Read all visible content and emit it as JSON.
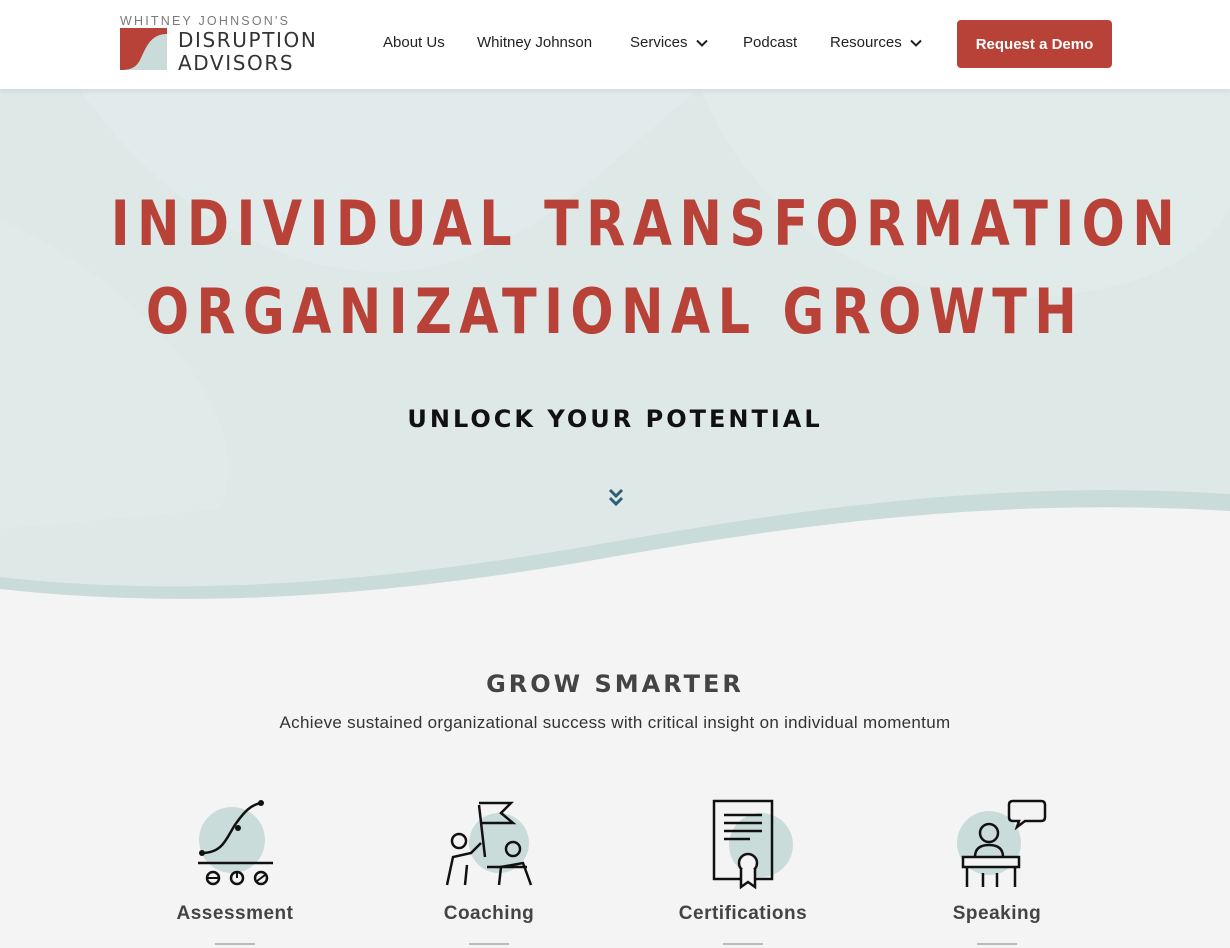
{
  "brand": {
    "top_line": "WHITNEY JOHNSON'S",
    "line1": "DISRUPTION",
    "line2": "ADVISORS",
    "colors": {
      "red": "#b84238",
      "teal": "#c9dcd9"
    }
  },
  "nav": {
    "items": [
      {
        "label": "About Us",
        "dropdown": false
      },
      {
        "label": "Whitney Johnson",
        "dropdown": false
      },
      {
        "label": "Services",
        "dropdown": true
      },
      {
        "label": "Podcast",
        "dropdown": false
      },
      {
        "label": "Resources",
        "dropdown": true
      }
    ],
    "cta_label": "Request a Demo"
  },
  "hero": {
    "title_line1": "INDIVIDUAL TRANSFORMATION",
    "title_line2": "ORGANIZATIONAL GROWTH",
    "subtitle": "UNLOCK YOUR POTENTIAL",
    "scroll_icon": "double-chevron-down-icon"
  },
  "grow": {
    "title": "GROW SMARTER",
    "subtitle": "Achieve sustained organizational success with critical insight on individual momentum",
    "services": [
      {
        "label": "Assessment",
        "icon": "s-curve-chart-icon"
      },
      {
        "label": "Coaching",
        "icon": "flag-team-icon"
      },
      {
        "label": "Certifications",
        "icon": "certificate-icon"
      },
      {
        "label": "Speaking",
        "icon": "speaker-podium-icon"
      }
    ]
  }
}
